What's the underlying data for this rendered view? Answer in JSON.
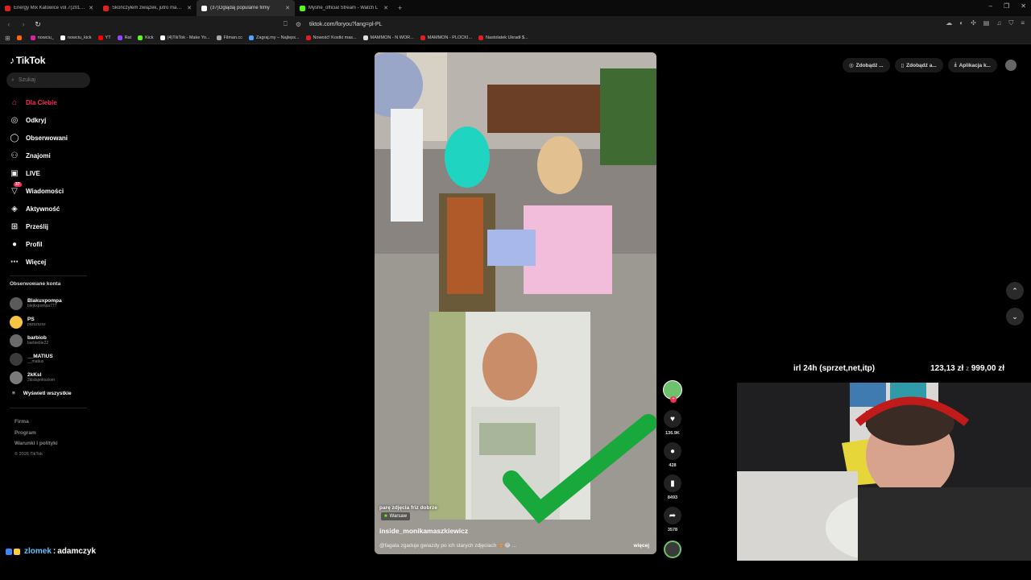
{
  "browser": {
    "tabs": [
      {
        "title": "Energy Mix Katowice vol.7(2017) Re",
        "color": "#e02020",
        "active": false
      },
      {
        "title": "Skończyłem związek, jutro masz się",
        "color": "#e02020",
        "active": false
      },
      {
        "title": "(37)Oglądaj popularne filmy",
        "color": "#ffffff",
        "active": true
      },
      {
        "title": "Myshe_official Stream - Watch L",
        "color": "#53fc18",
        "active": false
      }
    ],
    "url": "tiktok.com/foryou?lang=pl-PL",
    "bookmarks": [
      {
        "label": "",
        "color": "#ff6600"
      },
      {
        "label": "nowciu_",
        "color": "#d6249f"
      },
      {
        "label": "nowciu_kick",
        "color": "#ffffff"
      },
      {
        "label": "YT",
        "color": "#ff0000"
      },
      {
        "label": "Rat",
        "color": "#9146ff"
      },
      {
        "label": "Kick",
        "color": "#53fc18"
      },
      {
        "label": "(4)TikTok - Make Yo...",
        "color": "#ffffff"
      },
      {
        "label": "Filman.cc",
        "color": "#aaaaaa"
      },
      {
        "label": "Zagraj.my – Najleps...",
        "color": "#4da3ff"
      },
      {
        "label": "Nowość! Kostki mas...",
        "color": "#e02020"
      },
      {
        "label": "MAMMON - N WOR...",
        "color": "#dddddd"
      },
      {
        "label": "MAMMON - PLOCKI...",
        "color": "#e02020"
      },
      {
        "label": "Nastolatek Ukradł $...",
        "color": "#e02020"
      }
    ]
  },
  "tiktok": {
    "logo": "TikTok",
    "search_placeholder": "Szukaj",
    "nav": [
      {
        "label": "Dla Ciebie",
        "icon": "home-icon",
        "glyph": "⌂",
        "active": true
      },
      {
        "label": "Odkryj",
        "icon": "compass-icon",
        "glyph": "◎",
        "active": false
      },
      {
        "label": "Obserwowani",
        "icon": "following-icon",
        "glyph": "◯",
        "active": false
      },
      {
        "label": "Znajomi",
        "icon": "friends-icon",
        "glyph": "⚇",
        "active": false
      },
      {
        "label": "LIVE",
        "icon": "live-icon",
        "glyph": "▣",
        "active": false
      },
      {
        "label": "Wiadomości",
        "icon": "messages-icon",
        "glyph": "▽",
        "active": false,
        "badge": "37"
      },
      {
        "label": "Aktywność",
        "icon": "activity-icon",
        "glyph": "◈",
        "active": false
      },
      {
        "label": "Prześlij",
        "icon": "upload-icon",
        "glyph": "⊞",
        "active": false
      },
      {
        "label": "Profil",
        "icon": "profile-icon",
        "glyph": "●",
        "active": false
      },
      {
        "label": "Więcej",
        "icon": "more-icon",
        "glyph": "⋯",
        "active": false
      }
    ],
    "following_title": "Obserwowane konta",
    "following": [
      {
        "name": "Blakuxpompa",
        "handle": "blejkxpompa777",
        "color": "#5a5a5a"
      },
      {
        "name": "PS",
        "handle": "pszszszsz",
        "color": "#f5c542"
      },
      {
        "name": "barbiob",
        "handle": "barbiebie22",
        "color": "#6a6a6a"
      },
      {
        "name": "__MATIUS",
        "handle": "__matius",
        "color": "#3b3b3b"
      },
      {
        "name": "2kKsl",
        "handle": "2klslspokoziom",
        "color": "#7a7a7a"
      }
    ],
    "show_all": "Wyświetl wszystkie",
    "footer": [
      "Firma",
      "Program",
      "Warunki i polityki"
    ],
    "copyright": "© 2026 TikTok",
    "top_right": [
      "Zdobądź ...",
      "Zdobądź a...",
      "Aplikacja k..."
    ]
  },
  "video": {
    "caption": "parę zdjęcia friz dobrze",
    "location": "Warsaw",
    "author": "inside_monikamaszkiewicz",
    "description": "@fagata zgaduje gwiazdy po ich starych zdjęciach 🙈😂 ...",
    "more_label": "więcej",
    "likes": "136.9K",
    "comments": "428",
    "saves": "8493",
    "shares": "3578"
  },
  "stream": {
    "goal_label": "irl 24h (sprzet,net,itp)",
    "goal_current": "123,13 zł",
    "goal_sep": "z",
    "goal_target": "999,00 zł",
    "chat_user": "zlomek",
    "chat_sep": ":",
    "chat_message": "adamczyk"
  }
}
